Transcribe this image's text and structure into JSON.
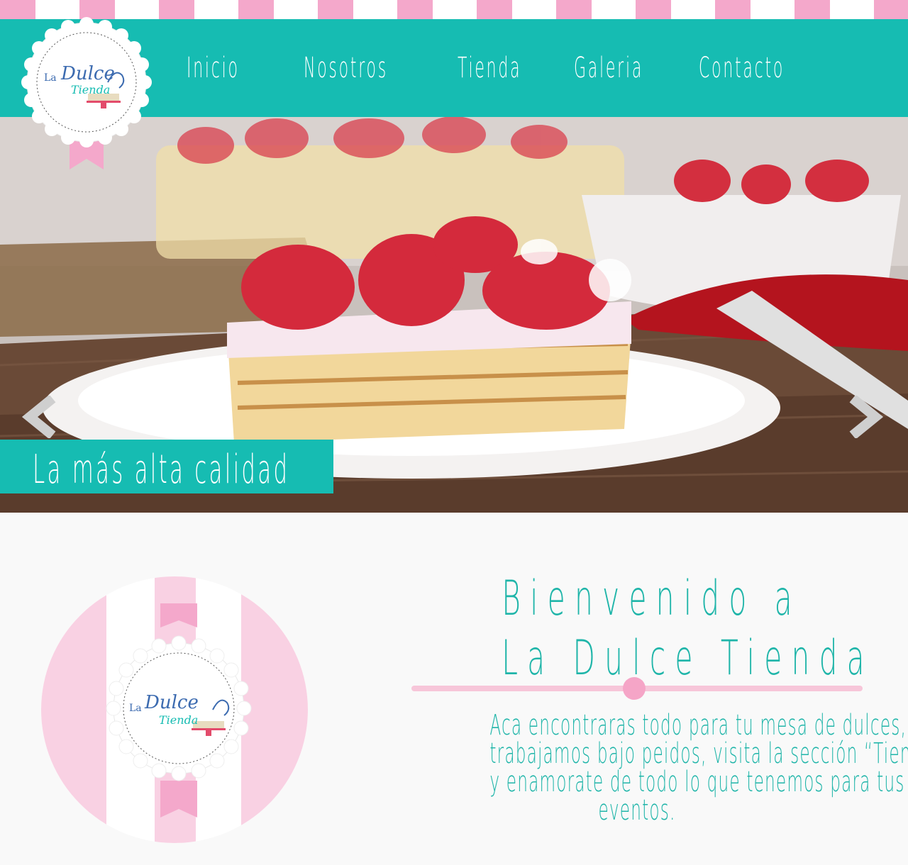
{
  "brand": {
    "name_top": "La",
    "name_mid": "Dulce",
    "name_bottom": "Tienda"
  },
  "nav": {
    "items": [
      {
        "label": "Inicio"
      },
      {
        "label": "Nosotros"
      },
      {
        "label": "Tienda"
      },
      {
        "label": "Galeria"
      },
      {
        "label": "Contacto"
      }
    ]
  },
  "hero": {
    "caption": "La más alta calidad",
    "prev_icon": "chevron-left-icon",
    "next_icon": "chevron-right-icon"
  },
  "welcome": {
    "title_line1": "Bienvenido a",
    "title_line2": "La Dulce Tienda",
    "text_lines": [
      "Aca encontraras todo para tu mesa de dulces,",
      "trabajamos bajo peidos, visita la sección “Tienda”",
      "y enamorate de todo lo que tenemos para tus",
      "eventos."
    ]
  },
  "colors": {
    "teal": "#16bcb2",
    "pink": "#f4a8cb",
    "light_pink": "#f7c6d9",
    "white": "#ffffff"
  }
}
